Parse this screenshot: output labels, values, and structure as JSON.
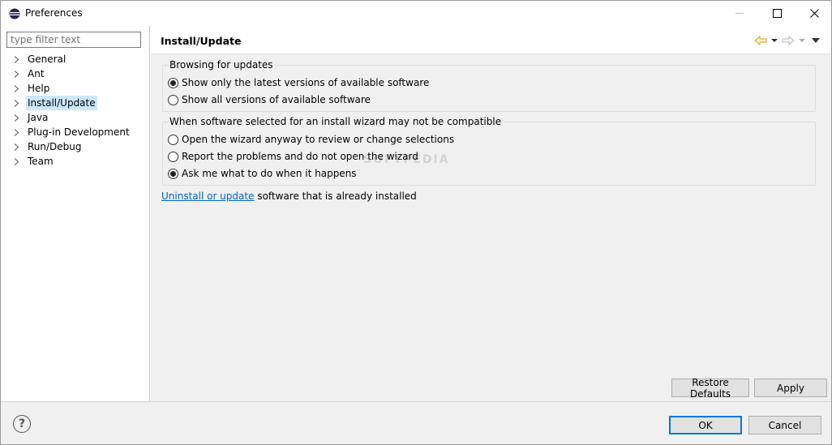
{
  "window": {
    "title": "Preferences"
  },
  "sidebar": {
    "filter_placeholder": "type filter text",
    "items": [
      {
        "label": "General"
      },
      {
        "label": "Ant"
      },
      {
        "label": "Help"
      },
      {
        "label": "Install/Update",
        "selected": true
      },
      {
        "label": "Java"
      },
      {
        "label": "Plug-in Development"
      },
      {
        "label": "Run/Debug"
      },
      {
        "label": "Team"
      }
    ]
  },
  "page": {
    "title": "Install/Update",
    "browsing": {
      "legend": "Browsing for updates",
      "options": [
        {
          "label": "Show only the latest versions of available software",
          "checked": true
        },
        {
          "label": "Show all versions of available software",
          "checked": false
        }
      ]
    },
    "compat": {
      "legend": "When software selected for an install wizard may not be compatible",
      "options": [
        {
          "label": "Open the wizard anyway to review or change selections",
          "checked": false
        },
        {
          "label": "Report the problems and do not open the wizard",
          "checked": false
        },
        {
          "label": "Ask me what to do when it happens",
          "checked": true
        }
      ]
    },
    "link_text": "Uninstall or update",
    "link_suffix": " software that is already installed",
    "watermark": "SOFTPEDIA",
    "restore_label": "Restore Defaults",
    "apply_label": "Apply"
  },
  "footer": {
    "help_label": "?",
    "ok_label": "OK",
    "cancel_label": "Cancel"
  },
  "colors": {
    "accent": "#0078d7",
    "link": "#0066cc",
    "selection": "#cce8ff"
  }
}
